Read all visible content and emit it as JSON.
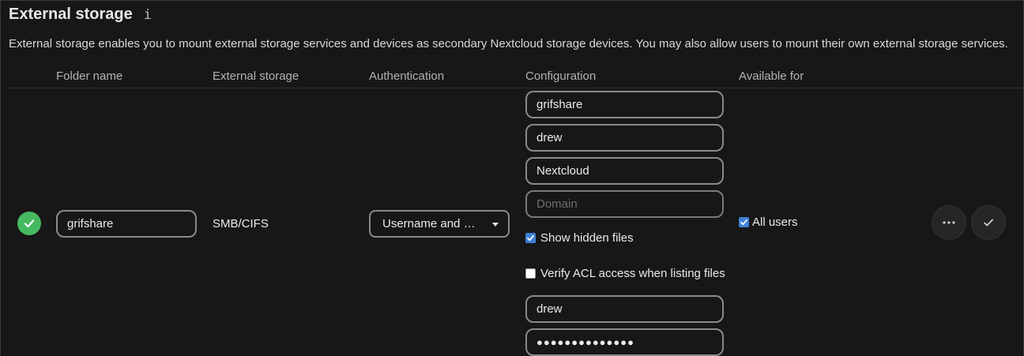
{
  "section": {
    "title": "External storage",
    "info_icon": "i",
    "description": "External storage enables you to mount external storage services and devices as secondary Nextcloud storage devices. You may also allow users to mount their own external storage services."
  },
  "table": {
    "headers": {
      "folder_name": "Folder name",
      "external_storage": "External storage",
      "authentication": "Authentication",
      "configuration": "Configuration",
      "available_for": "Available for"
    },
    "row": {
      "status": "ok",
      "folder_name": "grifshare",
      "backend": "SMB/CIFS",
      "auth_method": "Username and password",
      "config": {
        "host": "grifshare",
        "share": "drew",
        "remote_subfolder": "Nextcloud",
        "domain_placeholder": "Domain",
        "show_hidden_label": "Show hidden files",
        "show_hidden_checked": true,
        "verify_acl_label": "Verify ACL access when listing files",
        "verify_acl_checked": false,
        "login": "drew",
        "password_mask": "●●●●●●●●●●●●●●"
      },
      "available_for": {
        "label": "All users",
        "checked": true
      }
    }
  },
  "colors": {
    "background": "#171717",
    "status_ok": "#46ba61",
    "checkbox": "#3f7fd6"
  }
}
